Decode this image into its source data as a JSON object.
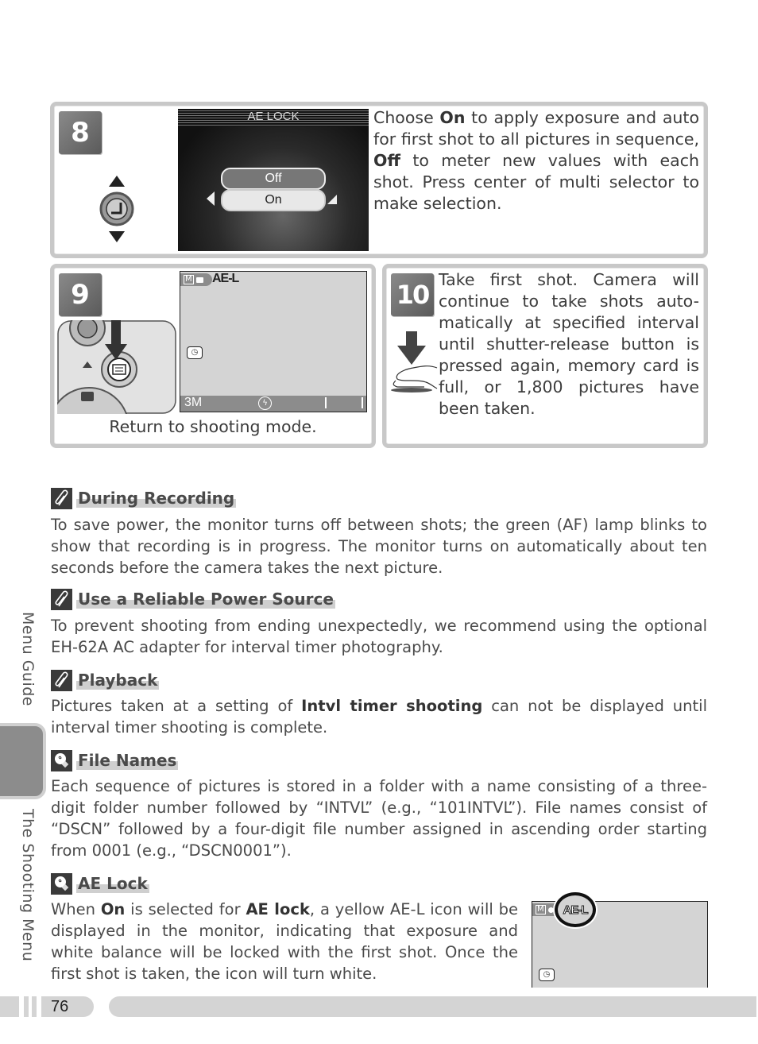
{
  "steps": [
    {
      "number": "8",
      "lcd_title": "AE LOCK",
      "options": [
        "Off",
        "On"
      ],
      "selected_option": "On",
      "text_parts": [
        {
          "t": "Choose ",
          "b": false
        },
        {
          "t": "On",
          "b": true
        },
        {
          "t": " to apply exposure and auto for first shot to all pictures in sequence, ",
          "b": false
        },
        {
          "t": "Off",
          "b": true
        },
        {
          "t": " to meter new values with each shot.  Press center of multi selector to make selection.",
          "b": false
        }
      ],
      "icons": [
        "multi-selector-up-down-icon"
      ]
    },
    {
      "number": "9",
      "lcd_ael_label": "AE-L",
      "lcd_mode_label": "M",
      "lcd_size_label": "3M",
      "caption": "Return to shooting mode.",
      "icons": [
        "menu-button-icon",
        "interval-timer-icon",
        "flash-off-icon"
      ]
    },
    {
      "number": "10",
      "text": "Take first shot.  Camera will continue to take shots auto-matically at specified interval until shutter-release button is pressed again, memory card is full, or 1,800 pictures have been taken.",
      "icons": [
        "shutter-press-icon"
      ]
    }
  ],
  "notes": [
    {
      "icon": "paperclip-icon",
      "title": "During Recording",
      "body_parts": [
        {
          "t": "To save power, the monitor turns off between shots; the green (AF) lamp blinks to show that recording is in progress.  The monitor turns on automatically about ten seconds before the camera takes the next picture.",
          "b": false
        }
      ]
    },
    {
      "icon": "paperclip-icon",
      "title": "Use a Reliable Power Source",
      "body_parts": [
        {
          "t": "To prevent shooting from ending unexpectedly, we recommend using the optional EH-62A AC adapter for interval timer photography.",
          "b": false
        }
      ]
    },
    {
      "icon": "paperclip-icon",
      "title": "Playback",
      "body_parts": [
        {
          "t": "Pictures taken at a setting of ",
          "b": false
        },
        {
          "t": "Intvl timer shooting",
          "b": true
        },
        {
          "t": " can not be displayed until interval timer shooting is complete.",
          "b": false
        }
      ]
    },
    {
      "icon": "lightbulb-icon",
      "title": "File Names",
      "body_parts": [
        {
          "t": "Each sequence of pictures is stored in a folder with a name consisting of a three-digit folder number followed by “INTVL” (e.g., “101INTVL”).  File names consist of “DSCN” followed by a four-digit file number assigned in ascending order starting from 0001 (e.g., “DSCN0001”).",
          "b": false
        }
      ]
    },
    {
      "icon": "lightbulb-icon",
      "title": "AE Lock",
      "body_parts": [
        {
          "t": "When ",
          "b": false
        },
        {
          "t": "On",
          "b": true
        },
        {
          "t": " is selected for ",
          "b": false
        },
        {
          "t": "AE lock",
          "b": true
        },
        {
          "t": ", a yellow AE-L icon will be displayed in the monitor, indicating that exposure and white balance will be locked with the first shot.  Once the first shot is taken, the icon will turn white.",
          "b": false
        }
      ],
      "lcd_ael_label": "AE-L",
      "lcd_mode_label": "M"
    }
  ],
  "sidebar": {
    "section_top": "Menu Guide",
    "section_bottom": "The Shooting Menu"
  },
  "footer": {
    "page_number": "76"
  },
  "colors": {
    "box_border": "#c8c8c8",
    "step_badge": "#6e6e6e",
    "lcd_bg": "#d4d4d4",
    "tab_fill": "#8c8c8c"
  }
}
